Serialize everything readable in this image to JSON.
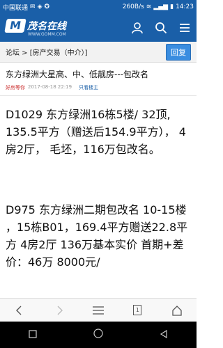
{
  "status_bar": {
    "carrier": "中国联通",
    "speed": "260B/s",
    "time": "14:23"
  },
  "app_bar": {
    "logo_mark": "M",
    "logo_text": "茂名在线",
    "logo_sub": "WWW.GOMM.COM",
    "icons": [
      "user-icon",
      "search-icon",
      "menu-icon"
    ]
  },
  "breadcrumb": {
    "text": "论坛 > [房产交易（中介）]",
    "reply_label": "回复"
  },
  "post": {
    "title": "东方绿洲大星高、中、低靓房---包改名",
    "author": "好房等你",
    "date": "2017-08-18 22:19",
    "only_op": "只看楼主"
  },
  "content": {
    "paragraph1": "D1029 东方绿洲16栋5楼/ 32顶, 135.5平方（赠送后154.9平方）， 4房2厅， 毛坯，116万包改名。",
    "paragraph2": "D975 东方绿洲二期包改名  10-15楼 ，15栋B01，169.4平方赠送22.8平方  4房2厅  136万基本实价  首期+差价：46万  8000元/"
  },
  "bottom_nav": {
    "page_number": "1",
    "icons": [
      "back-icon",
      "forward-icon",
      "menu-lines-icon",
      "page-icon",
      "home-icon"
    ]
  },
  "system_nav": {
    "icons": [
      "square-icon",
      "circle-icon",
      "triangle-back-icon"
    ]
  }
}
